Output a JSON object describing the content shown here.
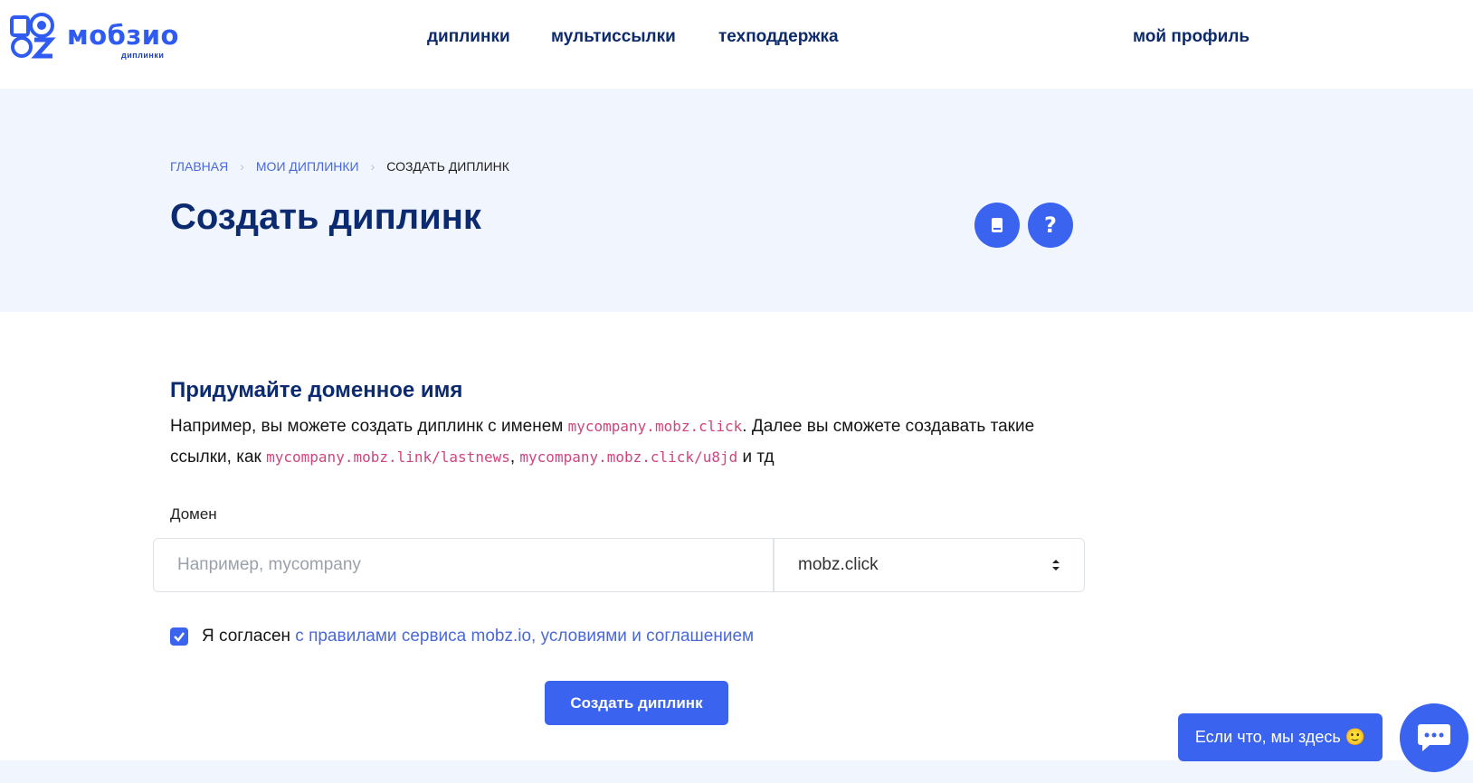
{
  "header": {
    "logo_text": "мобзио",
    "logo_sub": "диплинки",
    "nav": [
      "диплинки",
      "мультиссылки",
      "техподдержка"
    ],
    "profile": "мой профиль"
  },
  "breadcrumb": {
    "home": "ГЛАВНАЯ",
    "my_deeplinks": "МОИ ДИПЛИНКИ",
    "current": "СОЗДАТЬ ДИПЛИНК"
  },
  "page": {
    "title": "Создать диплинк",
    "icons": [
      "book-icon",
      "question-icon"
    ]
  },
  "form": {
    "heading": "Придумайте доменное имя",
    "desc_1": "Например, вы можете создать диплинк с именем ",
    "code_1": "mycompany.mobz.click",
    "desc_2": ". Далее вы сможете создавать такие ссылки, как ",
    "code_2": "mycompany.mobz.link/lastnews",
    "desc_3": ", ",
    "code_3": "mycompany.mobz.click/u8jd",
    "desc_4": " и тд",
    "domain_label": "Домен",
    "domain_placeholder": "Например, mycompany",
    "domain_value": "",
    "zone_selected": "mobz.click",
    "agree_text": "Я согласен ",
    "agree_link": "с правилами сервиса mobz.io, условиями и соглашением",
    "agree_checked": true,
    "submit_label": "Создать диплинк"
  },
  "chat": {
    "bubble_text": "Если что, мы здесь 🙂"
  },
  "colors": {
    "accent": "#3a63ef",
    "heading": "#0b2a6f",
    "hero_bg": "#f1f6fe",
    "code": "#d0457f",
    "link": "#4a68d9"
  }
}
